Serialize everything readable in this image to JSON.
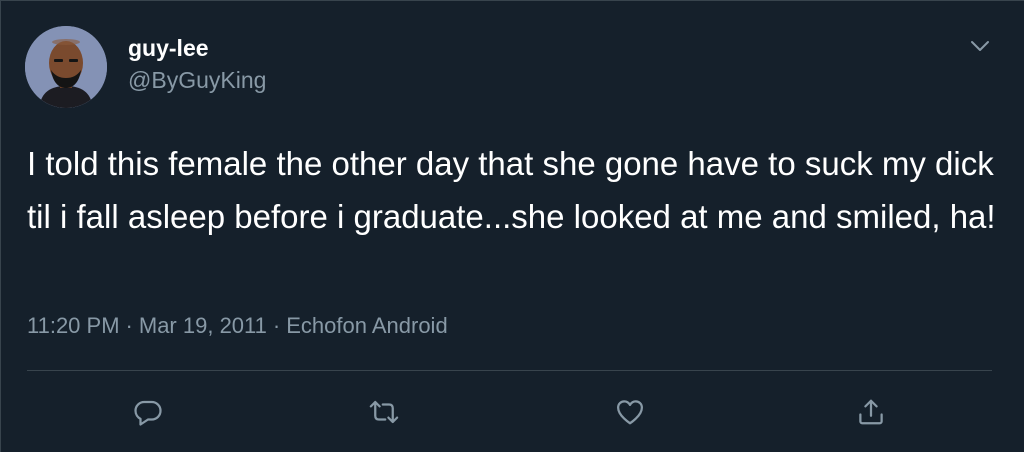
{
  "tweet": {
    "display_name": "guy-lee",
    "handle": "@ByGuyKing",
    "text": "I told this female the other day that she gone have to suck my dick til i fall asleep before i graduate...she looked at me and smiled, ha!",
    "time": "11:20 PM",
    "separator": "·",
    "date": "Mar 19, 2011",
    "source": "Echofon Android"
  },
  "icons": {
    "menu": "chevron-down-icon",
    "reply": "reply-icon",
    "retweet": "retweet-icon",
    "like": "heart-icon",
    "share": "share-icon"
  },
  "colors": {
    "background": "#15202b",
    "primary_text": "#ffffff",
    "secondary_text": "#8899a6",
    "divider": "#38444d",
    "avatar_bg": "#8492b5"
  }
}
